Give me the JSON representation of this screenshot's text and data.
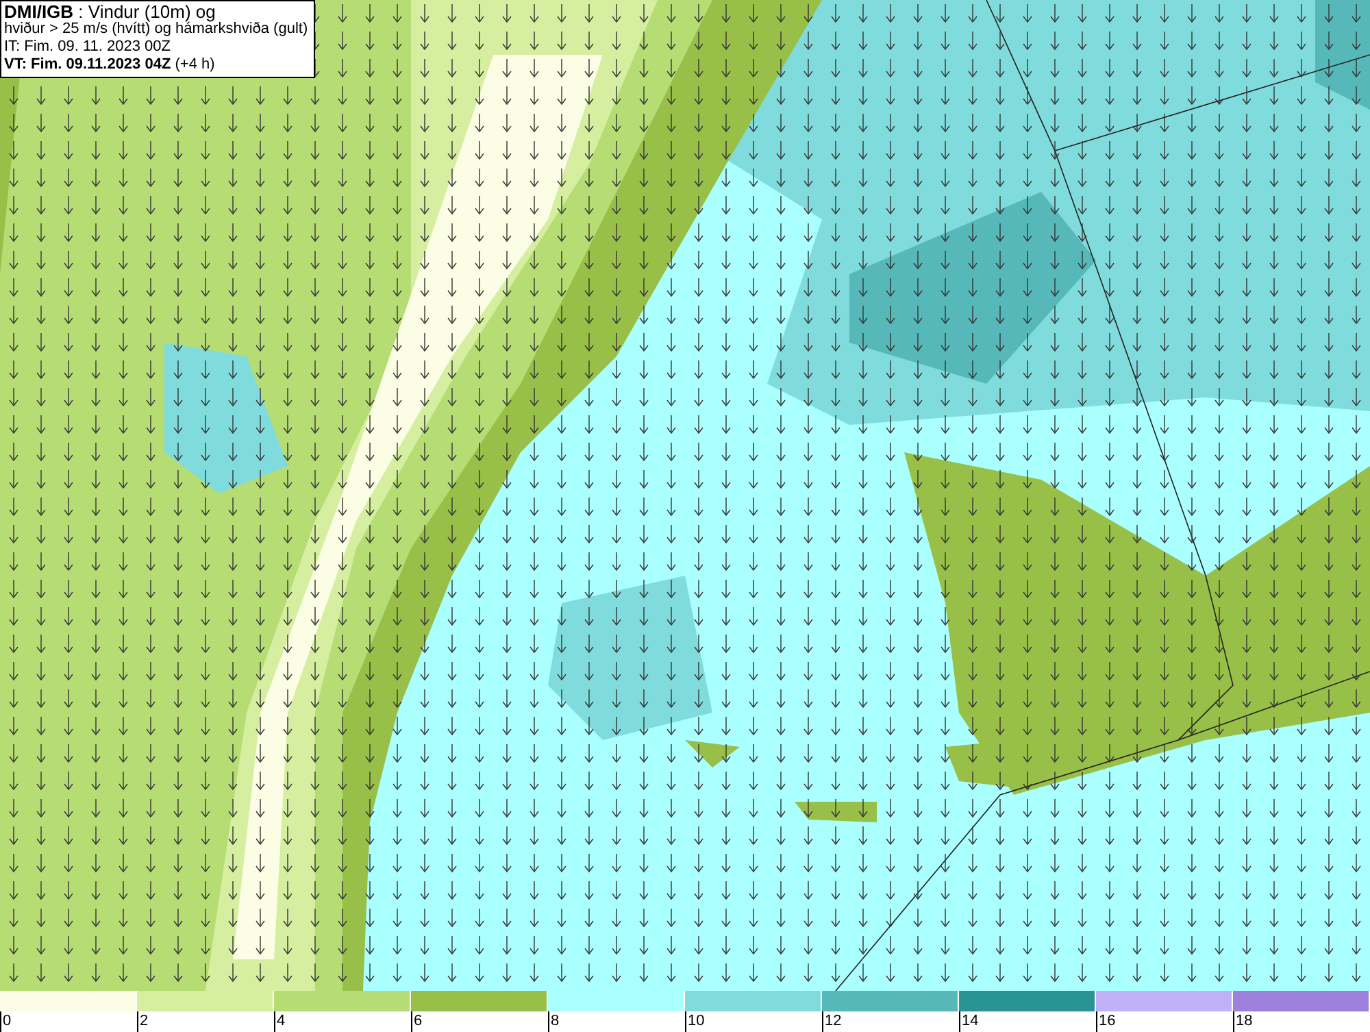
{
  "header": {
    "lines": [
      "**DMI/IGB** : Vindur (10m) og",
      "hviður > 25 m/s (hvítt) og hámarkshviða (gult)",
      "IT: Fim. 09. 11. 2023 00Z",
      "**VT: Fim. 09.11.2023 04Z** (+4 h)"
    ]
  },
  "legend": [
    {
      "label": "0",
      "color": "#fbfde4"
    },
    {
      "label": "2",
      "color": "#d6eea0"
    },
    {
      "label": "4",
      "color": "#b6dc74"
    },
    {
      "label": "6",
      "color": "#98c048"
    },
    {
      "label": "8",
      "color": "#aaffff"
    },
    {
      "label": "10",
      "color": "#80dcdc"
    },
    {
      "label": "12",
      "color": "#56b8b8"
    },
    {
      "label": "14",
      "color": "#2a9494"
    },
    {
      "label": "16",
      "color": "#c0b0f8"
    },
    {
      "label": "18",
      "color": "#9c80dc"
    }
  ]
}
